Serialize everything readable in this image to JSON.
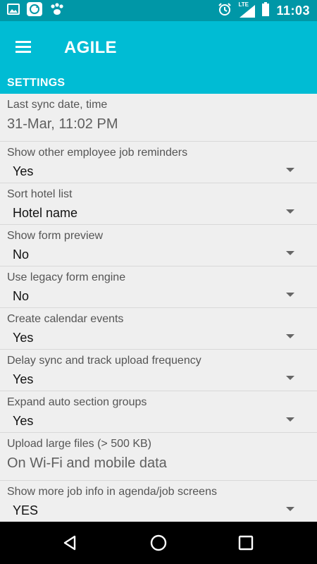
{
  "status_bar": {
    "time": "11:03",
    "network": "LTE",
    "left_icons": [
      "image-icon",
      "sync-app-icon",
      "paw-icon"
    ],
    "right_icons": [
      "alarm-icon",
      "signal-icon",
      "battery-icon"
    ]
  },
  "app_bar": {
    "title": "AGILE",
    "menu_icon": "menu-icon"
  },
  "section": {
    "title": "SETTINGS"
  },
  "settings": [
    {
      "label": "Last sync date, time",
      "value": "31-Mar, 11:02 PM",
      "type": "info"
    },
    {
      "label": "Show other employee job reminders",
      "value": "Yes",
      "type": "dropdown"
    },
    {
      "label": "Sort hotel list",
      "value": "Hotel name",
      "type": "dropdown"
    },
    {
      "label": "Show form preview",
      "value": "No",
      "type": "dropdown"
    },
    {
      "label": "Use legacy form engine",
      "value": "No",
      "type": "dropdown"
    },
    {
      "label": "Create calendar events",
      "value": "Yes",
      "type": "dropdown"
    },
    {
      "label": "Delay sync and track upload frequency",
      "value": "Yes",
      "type": "dropdown"
    },
    {
      "label": "Expand auto section groups",
      "value": "Yes",
      "type": "dropdown"
    },
    {
      "label": "Upload large files (> 500 KB)",
      "value": "On Wi-Fi and mobile data",
      "type": "info"
    },
    {
      "label": "Show more job info in agenda/job screens",
      "value": "YES",
      "type": "dropdown"
    }
  ],
  "nav_bar": {
    "buttons": [
      "back-icon",
      "home-icon",
      "recents-icon"
    ]
  },
  "colors": {
    "status_bar": "#0097a7",
    "app_bar": "#00bcd4",
    "background": "#efefef"
  }
}
